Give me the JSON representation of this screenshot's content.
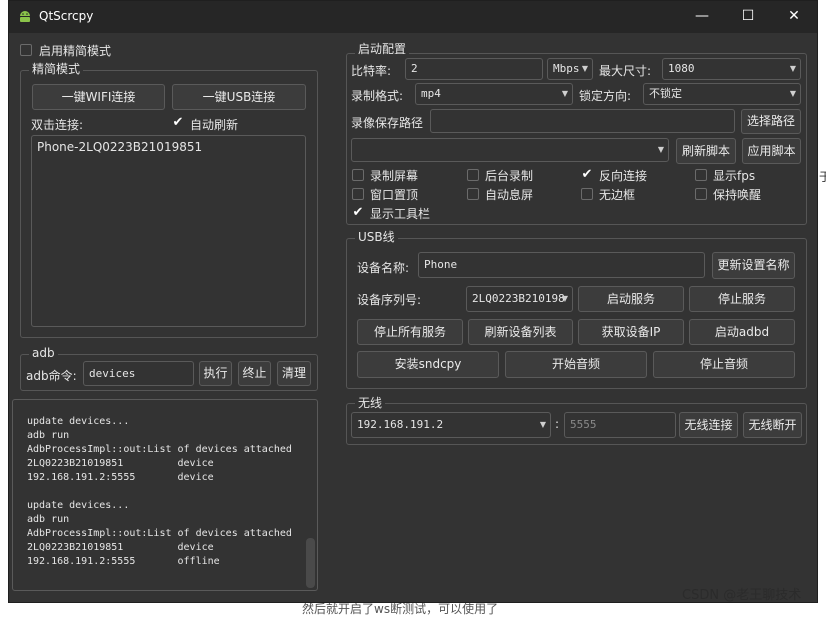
{
  "window": {
    "title": "QtScrcpy",
    "minimize": "—",
    "maximize": "☐",
    "close": "✕"
  },
  "simple_mode": {
    "checkbox_label": "启用精简模式",
    "group_title": "精简模式",
    "wifi_button": "一键WIFI连接",
    "usb_button": "一键USB连接",
    "double_click_label": "双击连接:",
    "auto_refresh_label": "自动刷新",
    "devices": [
      "Phone-2LQ0223B21019851"
    ]
  },
  "adb": {
    "group_title": "adb",
    "cmd_label": "adb命令:",
    "cmd_value": "devices",
    "exec_button": "执行",
    "stop_button": "终止",
    "clear_button": "清理"
  },
  "log": {
    "lines": [
      "update devices...",
      "adb run",
      "AdbProcessImpl::out:List of devices attached",
      "2LQ0223B21019851         device",
      "192.168.191.2:5555       device",
      "",
      "update devices...",
      "adb run",
      "AdbProcessImpl::out:List of devices attached",
      "2LQ0223B21019851         device",
      "192.168.191.2:5555       offline"
    ]
  },
  "start_config": {
    "group_title": "启动配置",
    "bitrate_label": "比特率:",
    "bitrate_value": "2",
    "bitrate_unit": "Mbps",
    "max_size_label": "最大尺寸:",
    "max_size_value": "1080",
    "record_format_label": "录制格式:",
    "record_format_value": "mp4",
    "lock_orientation_label": "锁定方向:",
    "lock_orientation_value": "不锁定",
    "record_path_label": "录像保存路径",
    "record_path_value": "",
    "select_path_button": "选择路径",
    "script_value": "",
    "refresh_script_button": "刷新脚本",
    "apply_script_button": "应用脚本",
    "options": [
      {
        "label": "录制屏幕",
        "checked": false
      },
      {
        "label": "后台录制",
        "checked": false
      },
      {
        "label": "反向连接",
        "checked": true
      },
      {
        "label": "显示fps",
        "checked": false
      },
      {
        "label": "窗口置顶",
        "checked": false
      },
      {
        "label": "自动息屏",
        "checked": false
      },
      {
        "label": "无边框",
        "checked": false
      },
      {
        "label": "保持唤醒",
        "checked": false
      },
      {
        "label": "显示工具栏",
        "checked": true
      }
    ]
  },
  "usb": {
    "group_title": "USB线",
    "device_name_label": "设备名称:",
    "device_name_value": "Phone",
    "update_name_button": "更新设置名称",
    "serial_label": "设备序列号:",
    "serial_value": "2LQ0223B210198",
    "start_service_button": "启动服务",
    "stop_service_button": "停止服务",
    "stop_all_button": "停止所有服务",
    "refresh_devices_button": "刷新设备列表",
    "get_ip_button": "获取设备IP",
    "start_adbd_button": "启动adbd",
    "install_sndcpy_button": "安装sndcpy",
    "start_audio_button": "开始音频",
    "stop_audio_button": "停止音频"
  },
  "wireless": {
    "group_title": "无线",
    "ip_value": "192.168.191.2",
    "separator": ":",
    "port_placeholder": "5555",
    "connect_button": "无线连接",
    "disconnect_button": "无线断开"
  },
  "background": {
    "watermark": "CSDN @老王聊技术",
    "bottom_text": "然后就开启了ws断测试，可以使用了",
    "right_char": "于"
  }
}
